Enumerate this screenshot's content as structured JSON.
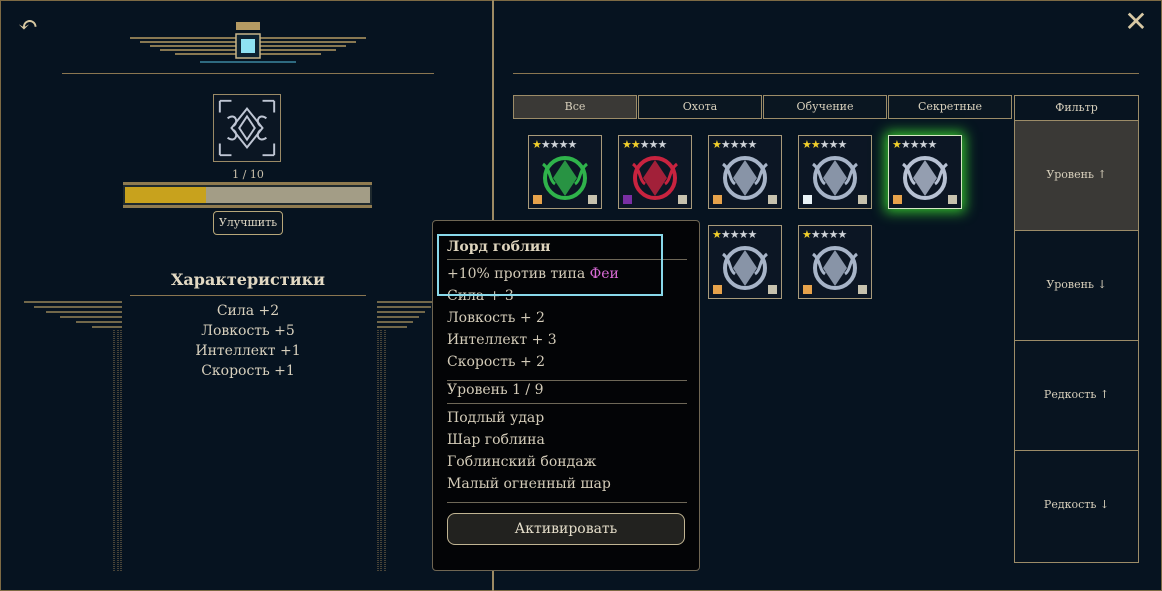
{
  "left_panel": {
    "level_text": "1 / 10",
    "progress": 0.33,
    "upgrade_label": "Улучшить",
    "stats_title": "Характеристики",
    "stats": [
      "Сила +2",
      "Ловкость +5",
      "Интеллект +1",
      "Скорость +1"
    ]
  },
  "tabs": [
    "Все",
    "Охота",
    "Обучение",
    "Секретные"
  ],
  "active_tab": "Все",
  "filter": {
    "header": "Фильтр",
    "options": [
      "Уровень ↑",
      "Уровень ↓",
      "Редкость ↑",
      "Редкость ↓"
    ]
  },
  "cards": [
    {
      "name": "goblin-green",
      "stars": 1,
      "gem_color": "#e7a24b",
      "art_color": "#2fb34b"
    },
    {
      "name": "dragon-red",
      "stars": 2,
      "gem_color": "#7a2fa3",
      "art_color": "#c8233f"
    },
    {
      "name": "sword-silver",
      "stars": 1,
      "gem_color": "#e7a24b",
      "art_color": "#a7b4c8"
    },
    {
      "name": "guardian-silver",
      "stars": 2,
      "gem_color": "#e9f2f6",
      "art_color": "#a7b4c8"
    },
    {
      "name": "emblem-selected",
      "stars": 1,
      "gem_color": "#e7a24b",
      "art_color": "#b7c1d3"
    },
    {
      "name": "hidden-blue",
      "stars": 0,
      "gem_color": "#e7a24b",
      "art_color": "#3a6f8a"
    },
    {
      "name": "hidden-dark",
      "stars": 0,
      "gem_color": "#e7a24b",
      "art_color": "#3d4450"
    },
    {
      "name": "orb-silver",
      "stars": 1,
      "gem_color": "#e7a24b",
      "art_color": "#a7b4c8"
    },
    {
      "name": "mask-silver",
      "stars": 1,
      "gem_color": "#e7a24b",
      "art_color": "#a7b4c8"
    }
  ],
  "tooltip": {
    "title": "Лорд гоблин",
    "bonus_prefix": "+10% против типа ",
    "bonus_type": "Феи",
    "stats": [
      "Сила + 3",
      "Ловкость + 2",
      "Интеллект + 3",
      "Скорость + 2"
    ],
    "level": "Уровень 1 / 9",
    "abilities": [
      "Подлый удар",
      "Шар гоблина",
      "Гоблинский бондаж",
      "Малый огненный шар"
    ],
    "activate_label": "Активировать"
  },
  "colors": {
    "accent_gold": "#c8a21d",
    "highlight_cyan": "#89d9ea",
    "selected_glow": "#35c42e",
    "type_pink": "#d96bd6"
  },
  "icons": {
    "back": "back-arrow-icon",
    "close": "close-icon"
  }
}
